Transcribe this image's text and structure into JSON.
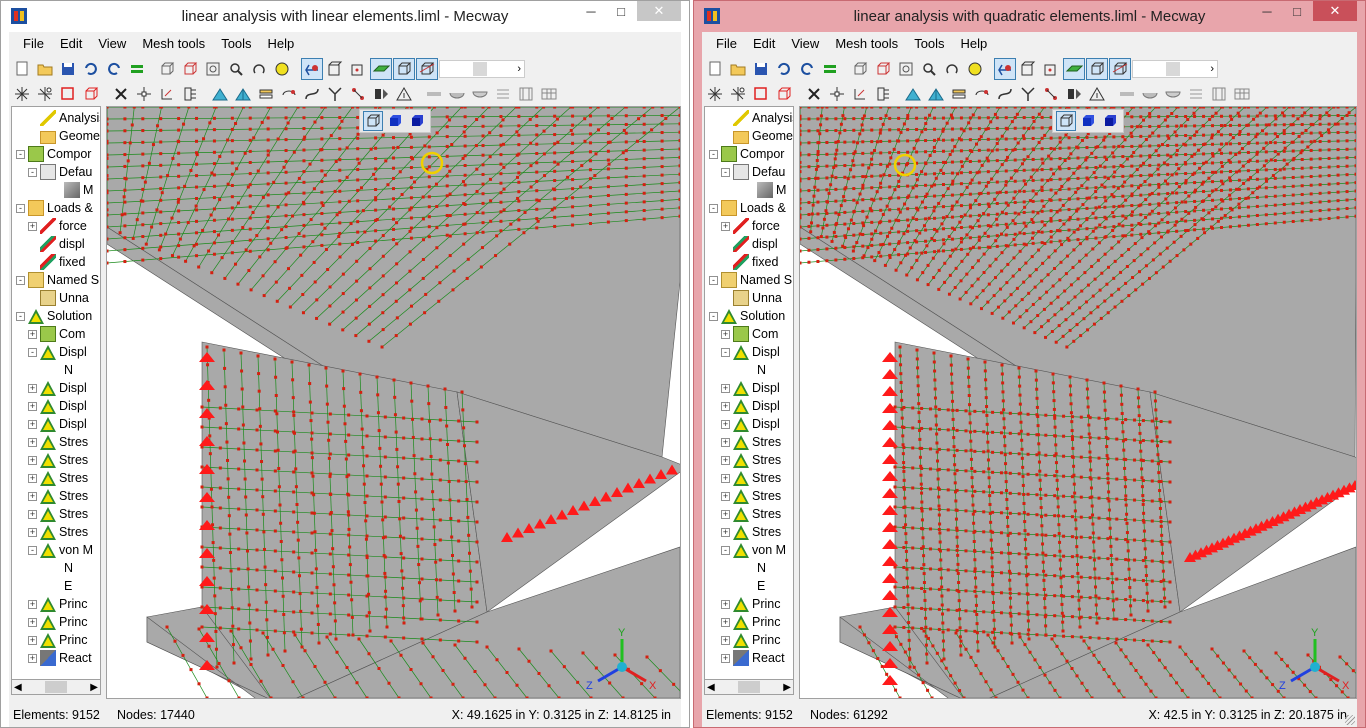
{
  "left": {
    "title": "linear analysis with linear elements.liml - Mecway",
    "status": {
      "elements": "Elements:  9152",
      "nodes": "Nodes: 17440",
      "coords": "X: 49.1625 in Y: 0.3125 in Z: 14.8125 in"
    },
    "mesh": "linear"
  },
  "right": {
    "title": "linear analysis with quadratic elements.liml - Mecway",
    "status": {
      "elements": "Elements:  9152",
      "nodes": "Nodes: 61292",
      "coords": "X: 42.5 in Y: 0.3125 in Z: 20.1875 in"
    },
    "mesh": "quadratic"
  },
  "window_buttons": {
    "minimize": "─",
    "maximize": "□",
    "close": "✕"
  },
  "menu": [
    "File",
    "Edit",
    "View",
    "Mesh tools",
    "Tools",
    "Help"
  ],
  "tree": [
    "Analysis",
    "Geometr",
    "Compor",
    "Defau",
    "M",
    "Loads &",
    "force",
    "displ",
    "fixed",
    "Named S",
    "Unna",
    "Solution",
    "Com",
    "Displ",
    "N",
    "Displ",
    "Displ",
    "Displ",
    "Stres",
    "Stres",
    "Stres",
    "Stres",
    "Stres",
    "Stres",
    "von M",
    "N",
    "E",
    "Princ",
    "Princ",
    "Princ",
    "React"
  ],
  "tree_icons": [
    "analysis",
    "folder",
    "comp",
    "def",
    "mesh",
    "loads",
    "force",
    "disp",
    "fixed",
    "named",
    "unn",
    "sol",
    "comp",
    "sol",
    "none",
    "sol",
    "sol",
    "sol",
    "sol",
    "sol",
    "sol",
    "sol",
    "sol",
    "sol",
    "sol",
    "none",
    "none",
    "sol",
    "sol",
    "sol",
    "react"
  ],
  "tree_indent": [
    1,
    1,
    0,
    1,
    3,
    0,
    1,
    1,
    1,
    0,
    1,
    0,
    1,
    1,
    3,
    1,
    1,
    1,
    1,
    1,
    1,
    1,
    1,
    1,
    1,
    3,
    3,
    1,
    1,
    1,
    1
  ],
  "tree_expander": [
    "",
    "",
    "-",
    "-",
    "",
    "-",
    "+",
    "",
    "",
    "-",
    "",
    "-",
    "+",
    "-",
    "",
    "+",
    "+",
    "+",
    "+",
    "+",
    "+",
    "+",
    "+",
    "+",
    "-",
    "",
    "",
    "+",
    "+",
    "+",
    "+"
  ],
  "axes": {
    "x": "X",
    "y": "Y",
    "z": "Z"
  },
  "colors": {
    "face": "#a9a9a9",
    "edge": "#1a8a1a",
    "node": "#d42010",
    "load": "#ff1a1a",
    "highlight": "#f0d000"
  }
}
